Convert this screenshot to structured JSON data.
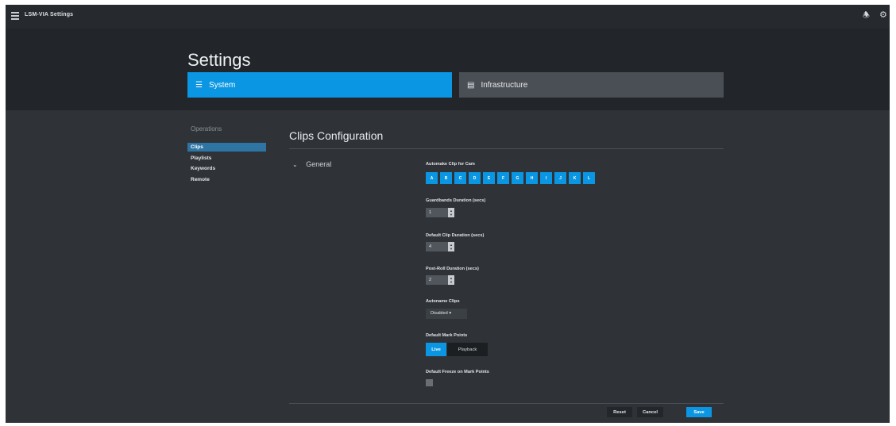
{
  "app": {
    "title": "LSM-VIA Settings"
  },
  "header": {
    "page_title": "Settings",
    "tabs": [
      {
        "label": "System",
        "icon": "sliders-icon",
        "active": true
      },
      {
        "label": "Infrastructure",
        "icon": "server-icon",
        "active": false
      }
    ]
  },
  "sidebar": {
    "heading": "Operations",
    "items": [
      {
        "label": "Clips",
        "active": true
      },
      {
        "label": "Playlists",
        "active": false
      },
      {
        "label": "Keywords",
        "active": false
      },
      {
        "label": "Remote",
        "active": false
      }
    ]
  },
  "main": {
    "section_title": "Clips Configuration",
    "group_label": "General",
    "automake": {
      "label": "Automake Clip for Cam",
      "cams": [
        "A",
        "B",
        "C",
        "D",
        "E",
        "F",
        "G",
        "H",
        "I",
        "J",
        "K",
        "L"
      ]
    },
    "guardbands": {
      "label": "Guardbands Duration (secs)",
      "value": "1"
    },
    "default_clip": {
      "label": "Default Clip Duration (secs)",
      "value": "4"
    },
    "post_roll": {
      "label": "Post-Roll Duration (secs)",
      "value": "2"
    },
    "autoname": {
      "label": "Autoname Clips",
      "value": "Disabled ▾"
    },
    "mark_points": {
      "label": "Default Mark Points",
      "options": [
        "Live",
        "Playback"
      ],
      "selected": "Live"
    },
    "freeze": {
      "label": "Default Freeze on Mark Points",
      "checked": false
    }
  },
  "footer": {
    "reset": "Reset",
    "cancel": "Cancel",
    "save": "Save"
  },
  "colors": {
    "accent": "#0a96e2",
    "background": "#2f3338",
    "header": "#222529"
  }
}
